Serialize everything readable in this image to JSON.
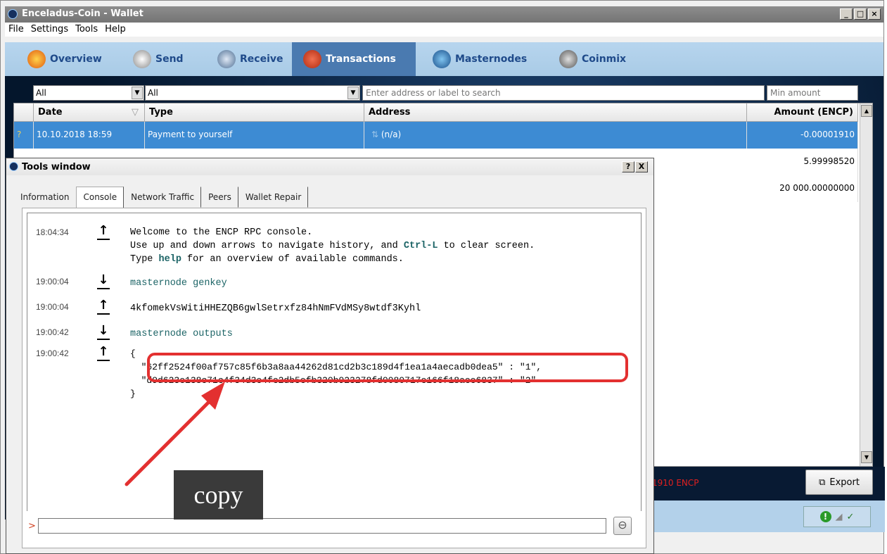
{
  "main_window": {
    "title": "Enceladus-Coin - Wallet",
    "menu": [
      "File",
      "Settings",
      "Tools",
      "Help"
    ],
    "nav": [
      {
        "label": "Overview",
        "icon": "overview-icon"
      },
      {
        "label": "Send",
        "icon": "send-icon"
      },
      {
        "label": "Receive",
        "icon": "receive-icon"
      },
      {
        "label": "Transactions",
        "icon": "transactions-icon",
        "active": true
      },
      {
        "label": "Masternodes",
        "icon": "masternodes-icon"
      },
      {
        "label": "Coinmix",
        "icon": "coinmix-icon"
      }
    ],
    "filters": {
      "date_value": "All",
      "type_value": "All",
      "search_placeholder": "Enter address or label to search",
      "min_amount_placeholder": "Min amount"
    },
    "table": {
      "headers": {
        "date": "Date",
        "type": "Type",
        "address": "Address",
        "amount": "Amount (ENCP)"
      },
      "rows": [
        {
          "date": "10.10.2018 18:59",
          "type": "Payment to yourself",
          "address": "(n/a)",
          "amount": "-0.00001910"
        },
        {
          "amount": "5.99998520"
        },
        {
          "amount": "20 000.00000000"
        }
      ]
    },
    "total_text": "1910 ENCP",
    "export_label": "Export"
  },
  "tools_window": {
    "title": "Tools window",
    "help_btn": "?",
    "close_btn": "X",
    "tabs": [
      "Information",
      "Console",
      "Network Traffic",
      "Peers",
      "Wallet Repair"
    ],
    "active_tab": "Console",
    "console": [
      {
        "time": "18:04:34",
        "dir": "↑",
        "lines": [
          "Welcome to the ENCP RPC console.",
          "Use up and down arrows to navigate history, and ",
          "Ctrl-L",
          " to clear screen.",
          "Type ",
          "help",
          " for an overview of available commands."
        ]
      },
      {
        "time": "19:00:04",
        "dir": "↓",
        "text": "masternode genkey"
      },
      {
        "time": "19:00:04",
        "dir": "↑",
        "text": "4kfomekVsWitiHHEZQB6gwlSetrxfz84hNmFVdMSy8wtdf3Kyhl"
      },
      {
        "time": "19:00:42",
        "dir": "↓",
        "text": "masternode outputs"
      },
      {
        "time": "19:00:42",
        "dir": "↑",
        "output": [
          "{",
          "  \"62ff2524f00af757c85f6b3a8aa44262d81cd2b3c189d4f1ea1a4aecadb0dea5\" : \"1\",",
          "  \"d9d623e138c71c4f34d3e4fe2db5efb320b923278fd0080717e166f18aee6837\" : \"2\"",
          "}"
        ]
      }
    ],
    "prompt": ">",
    "clear_icon": "⊖"
  },
  "annotation": {
    "label": "copy",
    "color": "#e33030"
  }
}
